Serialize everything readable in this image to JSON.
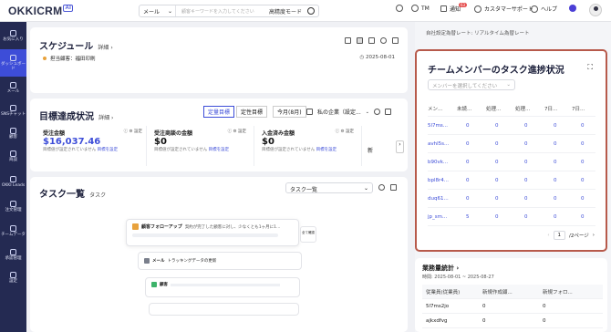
{
  "topbar": {
    "logo": "OKKICRM",
    "logo_badge": "AI",
    "search_select": "メール",
    "search_placeholder": "顧客キーワードを入力してください",
    "search_mode": "高精度モード",
    "user_initials": "TM",
    "notification_label": "通知",
    "notification_count": "63",
    "support_label": "カスタマーサポート",
    "help_label": "ヘルプ"
  },
  "sidebar": {
    "items": [
      {
        "label": "お気に入り",
        "icon": "star-icon"
      },
      {
        "label": "ダッシュボード",
        "icon": "dashboard-icon",
        "active": true
      },
      {
        "label": "メール",
        "icon": "mail-icon"
      },
      {
        "label": "SNSチャット",
        "icon": "chat-icon"
      },
      {
        "label": "顧客",
        "icon": "customer-icon"
      },
      {
        "label": "商談",
        "icon": "deal-icon"
      },
      {
        "label": "OKKI Leads",
        "icon": "leads-icon"
      },
      {
        "label": "注文管理",
        "icon": "order-icon"
      },
      {
        "label": "チームデータ",
        "icon": "team-data-icon"
      },
      {
        "label": "承認管理",
        "icon": "approval-icon"
      },
      {
        "label": "設定",
        "icon": "settings-icon"
      }
    ]
  },
  "schedule": {
    "title": "スケジュール",
    "detail": "詳細",
    "owner_label": "担当顧客：福田印刷",
    "date": "2025-08-01"
  },
  "goals": {
    "title": "目標達成状況",
    "detail": "詳細",
    "tabs": [
      "定量目標",
      "定性目標"
    ],
    "period": "今月(8月)",
    "my_company": "私の企業（設定...",
    "metrics": [
      {
        "label": "受注金額",
        "value": "$16,037.46",
        "sub": "目標値が設定されていません",
        "link": "目標を設定",
        "settings": "設定"
      },
      {
        "label": "受注商談の金額",
        "value": "$0",
        "sub": "目標値が設定されていません",
        "link": "目標を設定",
        "settings": "設定"
      },
      {
        "label": "入金済み金額",
        "value": "$0",
        "sub": "目標値が設定されていません",
        "link": "目標を設定",
        "settings": "設定"
      }
    ],
    "more": "新"
  },
  "tasks": {
    "title": "タスク一覧",
    "subtitle": "タスク",
    "view_select": "タスク一覧",
    "card1_title": "顧客フォローアップ",
    "card1_text": "契約が完了した顧客に対し、少なくとも1ヶ月に1...",
    "card1_date": "2025年8月",
    "card2_title": "メール",
    "card2_text": "トラッキングデータの更新",
    "card3_title": "顧客",
    "side_note": "全て確認"
  },
  "right": {
    "top_text": "自社設定為替レート: リアルタイム為替レート",
    "team_panel": {
      "title": "チームメンバーのタスク進捗状況",
      "member_select": "メンバーを選択してください",
      "columns": [
        "メン...",
        "未読...",
        "処理...",
        "処理...",
        "7日...",
        "7日..."
      ],
      "rows": [
        {
          "name": "5l7ms...",
          "vals": [
            "0",
            "0",
            "0",
            "0",
            "0"
          ]
        },
        {
          "name": "avhl5s...",
          "vals": [
            "0",
            "0",
            "0",
            "0",
            "0"
          ]
        },
        {
          "name": "b90vk...",
          "vals": [
            "0",
            "0",
            "0",
            "0",
            "0"
          ]
        },
        {
          "name": "bpl8r4...",
          "vals": [
            "0",
            "0",
            "0",
            "0",
            "0"
          ]
        },
        {
          "name": "duq61...",
          "vals": [
            "0",
            "0",
            "0",
            "0",
            "0"
          ]
        },
        {
          "name": "jp_sm...",
          "vals": [
            "5",
            "0",
            "0",
            "0",
            "0"
          ]
        }
      ],
      "page_current": "1",
      "page_total": "/2ページ"
    },
    "workload": {
      "title": "業務量統計",
      "period": "時間: 2025-08-01 ~ 2025-08-27",
      "columns": [
        "従業員(従業員)",
        "新規作成顧...",
        "新規フォロ..."
      ],
      "rows": [
        {
          "name": "5l7ms2jo",
          "vals": [
            "0",
            "0"
          ]
        },
        {
          "name": "ajkxdfvg",
          "vals": [
            "0",
            "0"
          ]
        }
      ]
    }
  }
}
